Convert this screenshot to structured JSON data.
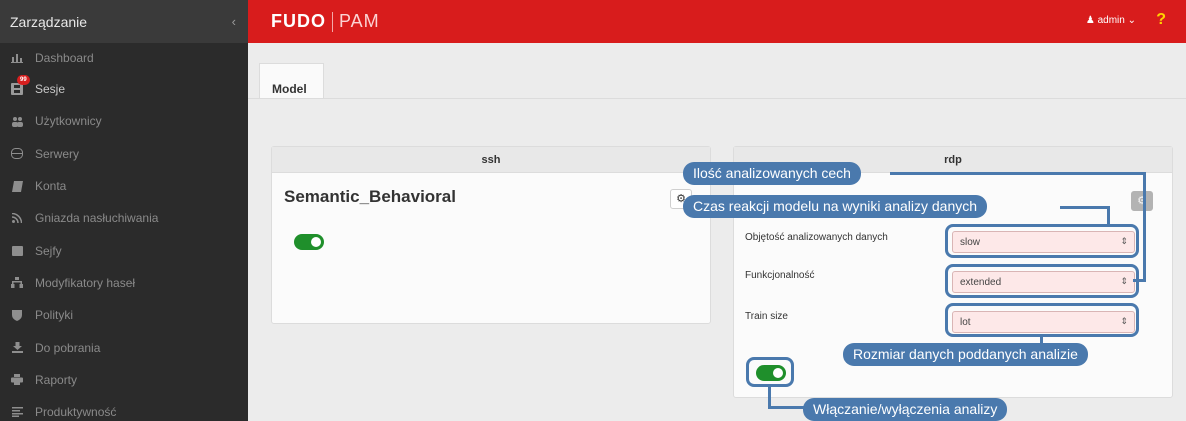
{
  "sidebar": {
    "title": "Zarządzanie",
    "items": [
      {
        "label": "Dashboard",
        "icon": "bar-chart-icon"
      },
      {
        "label": "Sesje",
        "icon": "film-icon",
        "badge": "99"
      },
      {
        "label": "Użytkownicy",
        "icon": "users-icon"
      },
      {
        "label": "Serwery",
        "icon": "server-icon"
      },
      {
        "label": "Konta",
        "icon": "book-icon"
      },
      {
        "label": "Gniazda nasłuchiwania",
        "icon": "rss-icon"
      },
      {
        "label": "Sejfy",
        "icon": "safe-icon"
      },
      {
        "label": "Modyfikatory haseł",
        "icon": "sitemap-icon"
      },
      {
        "label": "Polityki",
        "icon": "shield-icon"
      },
      {
        "label": "Do pobrania",
        "icon": "download-icon"
      },
      {
        "label": "Raporty",
        "icon": "print-icon"
      },
      {
        "label": "Produktywność",
        "icon": "list-icon"
      }
    ]
  },
  "topbar": {
    "logo_bold": "FUDO",
    "logo_light": "PAM",
    "user": "admin",
    "help": "?"
  },
  "tabs": [
    {
      "label": "Model"
    }
  ],
  "ssh_panel": {
    "header": "ssh",
    "model_name": "Semantic_Behavioral",
    "enabled": true
  },
  "rdp_panel": {
    "header": "rdp",
    "enabled": true,
    "fields": [
      {
        "label": "Objętość analizowanych danych",
        "value": "slow"
      },
      {
        "label": "Funkcjonalność",
        "value": "extended"
      },
      {
        "label": "Train size",
        "value": "lot"
      }
    ]
  },
  "callouts": {
    "features": "Ilość analizowanych cech",
    "reaction": "Czas reakcji modelu na wyniki analizy danych",
    "size": "Rozmiar danych poddanych analizie",
    "toggle": "Włączanie/wyłączenia analizy"
  },
  "colors": {
    "accent": "#d81c1c",
    "callout": "#4a79ad",
    "toggle_on": "#1f8f2b",
    "sidebar": "#2b2b2b"
  }
}
